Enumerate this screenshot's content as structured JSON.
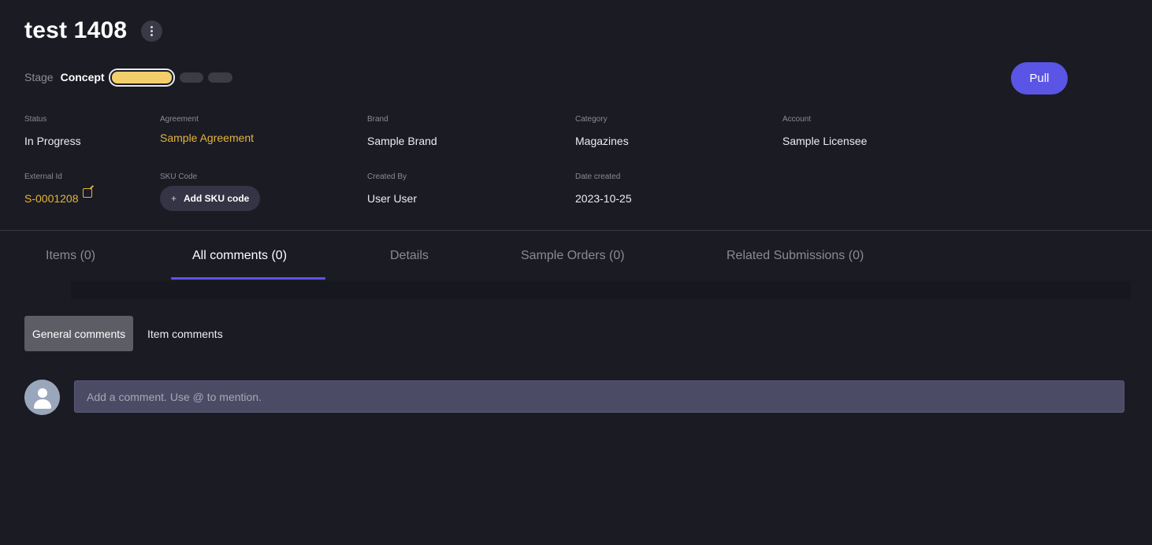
{
  "header": {
    "title": "test 1408",
    "more_icon": "more-vertical-icon",
    "stage_label": "Stage",
    "stage_value": "Concept",
    "stage_colors": {
      "active": "#f2cf6a",
      "inactive": "#3c3c47"
    },
    "pull_label": "Pull",
    "accent_color": "#5b55e6"
  },
  "fields": {
    "status": {
      "label": "Status",
      "value": "In Progress"
    },
    "agreement": {
      "label": "Agreement",
      "value": "Sample Agreement"
    },
    "brand": {
      "label": "Brand",
      "value": "Sample Brand"
    },
    "category": {
      "label": "Category",
      "value": "Magazines"
    },
    "account": {
      "label": "Account",
      "value": "Sample Licensee"
    },
    "external_id": {
      "label": "External Id",
      "value": "S-0001208",
      "icon": "external-link-icon"
    },
    "sku_code": {
      "label": "SKU Code",
      "button_label": "Add SKU code",
      "button_icon": "+"
    },
    "created_by": {
      "label": "Created By",
      "value": "User User"
    },
    "date_created": {
      "label": "Date created",
      "value": "2023-10-25"
    }
  },
  "tabs": [
    {
      "label": "Items (0)"
    },
    {
      "label": "All comments (0)"
    },
    {
      "label": "Details"
    },
    {
      "label": "Sample Orders (0)"
    },
    {
      "label": "Related Submissions (0)"
    }
  ],
  "comments": {
    "filters": [
      "General comments",
      "Item comments"
    ],
    "avatar_icon": "user-avatar-icon",
    "input_placeholder": "Add a comment. Use @ to mention.",
    "input_value": ""
  }
}
